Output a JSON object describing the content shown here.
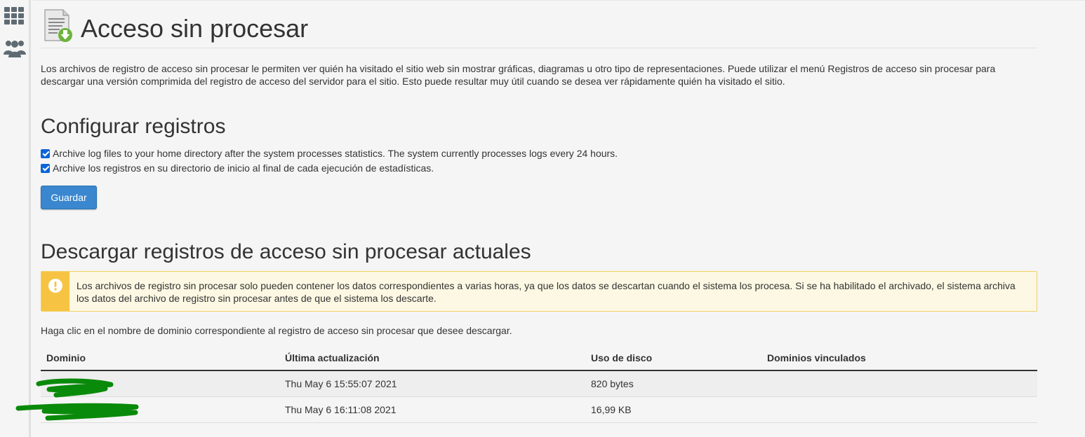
{
  "sidebar": {
    "items": [
      {
        "icon": "grid-icon"
      },
      {
        "icon": "users-icon"
      }
    ]
  },
  "header": {
    "title": "Acceso sin procesar",
    "icon": "raw-log-download-icon"
  },
  "intro": "Los archivos de registro de acceso sin procesar le permiten ver quién ha visitado el sitio web sin mostrar gráficas, diagramas u otro tipo de representaciones. Puede utilizar el menú Registros de acceso sin procesar para descargar una versión comprimida del registro de acceso del servidor para el sitio. Esto puede resultar muy útil cuando se desea ver rápidamente quién ha visitado el sitio.",
  "config": {
    "heading": "Configurar registros",
    "options": [
      {
        "label": "Archive log files to your home directory after the system processes statistics. The system currently processes logs every 24 hours.",
        "checked": true
      },
      {
        "label": "Archive los registros en su directorio de inicio al final de cada ejecución de estadísticas.",
        "checked": true
      }
    ],
    "save_label": "Guardar"
  },
  "download": {
    "heading": "Descargar registros de acceso sin procesar actuales",
    "alert": "Los archivos de registro sin procesar solo pueden contener los datos correspondientes a varias horas, ya que los datos se descartan cuando el sistema los procesa. Si se ha habilitado el archivado, el sistema archiva los datos del archivo de registro sin procesar antes de que el sistema los descarte.",
    "hint": "Haga clic en el nombre de dominio correspondiente al registro de acceso sin procesar que desee descargar.",
    "table": {
      "headers": [
        "Dominio",
        "Última actualización",
        "Uso de disco",
        "Dominios vinculados"
      ],
      "rows": [
        {
          "domain": "",
          "updated": "Thu May 6 15:55:07 2021",
          "disk": "820 bytes",
          "linked": ""
        },
        {
          "domain": "",
          "updated": "Thu May 6 16:11:08 2021",
          "disk": "16,99 KB",
          "linked": ""
        }
      ]
    }
  },
  "colors": {
    "primary_button": "#3a87cf",
    "warning_bar": "#f6c342",
    "warning_bg": "#fcf8e3",
    "checkbox": "#0b64d8",
    "redaction": "#0a8a0a"
  }
}
